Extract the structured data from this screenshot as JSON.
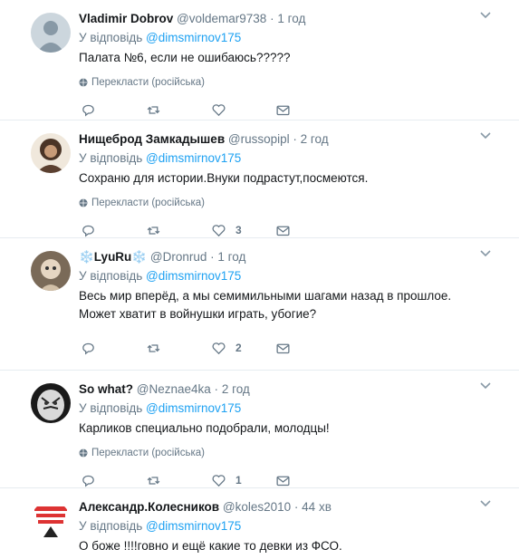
{
  "reply_prefix": "У відповідь",
  "translate_label": "Перекласти (російська)",
  "tweets": [
    {
      "name": "Vladimir Dobrov",
      "handle": "@voldemar9738",
      "time": "1 год",
      "mention": "@dimsmirnov175",
      "text": "Палата №6, если не ошибаюсь?????",
      "likes": ""
    },
    {
      "name": "Нищеброд Замкадышев",
      "handle": "@russopipl",
      "time": "2 год",
      "mention": "@dimsmirnov175",
      "text": "Сохраню для истории.Внуки подрастут,посмеются.",
      "likes": "3"
    },
    {
      "name": "❄️LyuRu❄️",
      "handle": "@Dronrud",
      "time": "1 год",
      "mention": "@dimsmirnov175",
      "text": "Весь мир вперёд, а мы семимильными шагами назад в прошлое. Может хватит в войнушки играть, убогие?",
      "likes": "2"
    },
    {
      "name": "So what?",
      "handle": "@Neznae4ka",
      "time": "2 год",
      "mention": "@dimsmirnov175",
      "text": "Карликов специально подобрали, молодцы!",
      "likes": "1"
    },
    {
      "name": "Александр.Колесников",
      "handle": "@koles2010",
      "time": "44 хв",
      "mention": "@dimsmirnov175",
      "text": "О боже !!!!говно и ещё какие то девки из ФСО.",
      "likes": ""
    }
  ],
  "colors": {
    "link": "#1da1f2",
    "muted": "#657786",
    "text": "#14171a",
    "border": "#e6ecf0"
  }
}
